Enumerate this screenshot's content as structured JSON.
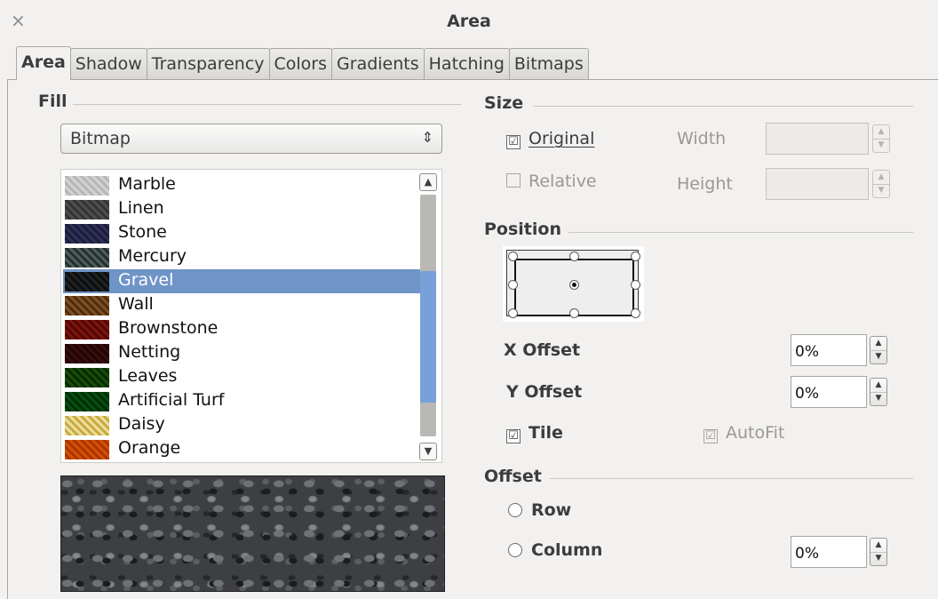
{
  "window": {
    "title": "Area",
    "close_glyph": "×"
  },
  "tabs": [
    "Area",
    "Shadow",
    "Transparency",
    "Colors",
    "Gradients",
    "Hatching",
    "Bitmaps"
  ],
  "fill": {
    "group_label": "Fill",
    "type_value": "Bitmap",
    "bitmaps": [
      {
        "label": "Marble",
        "swatch_colors": [
          "#e7e7e7",
          "#c8c8c8"
        ]
      },
      {
        "label": "Linen",
        "swatch_colors": [
          "#8d8d8d",
          "#5c5c5c"
        ]
      },
      {
        "label": "Stone",
        "swatch_colors": [
          "#6e6f94",
          "#3d3f63"
        ]
      },
      {
        "label": "Mercury",
        "swatch_colors": [
          "#8c9a98",
          "#3f4a48"
        ]
      },
      {
        "label": "Gravel",
        "swatch_colors": [
          "#5a5c5f",
          "#1f2022"
        ]
      },
      {
        "label": "Wall",
        "swatch_colors": [
          "#b48e5a",
          "#6a4f2c"
        ]
      },
      {
        "label": "Brownstone",
        "swatch_colors": [
          "#b3453a",
          "#6e1e18"
        ]
      },
      {
        "label": "Netting",
        "swatch_colors": [
          "#7a3a38",
          "#3a1a18"
        ]
      },
      {
        "label": "Leaves",
        "swatch_colors": [
          "#4f8d2e",
          "#1e4a12"
        ]
      },
      {
        "label": "Artificial Turf",
        "swatch_colors": [
          "#1e8e3e",
          "#0b4d1f"
        ]
      },
      {
        "label": "Daisy",
        "swatch_colors": [
          "#f2eec8",
          "#d8b24a"
        ]
      },
      {
        "label": "Orange",
        "swatch_colors": [
          "#e98e1d",
          "#b5620c"
        ]
      }
    ],
    "selected": "Gravel"
  },
  "size": {
    "group_label": "Size",
    "original_label": "Original",
    "original_checked": true,
    "relative_label": "Relative",
    "relative_checked": false,
    "width_label": "Width",
    "width_value": "",
    "height_label": "Height",
    "height_value": ""
  },
  "position": {
    "group_label": "Position",
    "selected_point": "center",
    "x_offset_label": "X Offset",
    "x_offset_value": "0%",
    "y_offset_label": "Y Offset",
    "y_offset_value": "0%",
    "tile_label": "Tile",
    "tile_checked": true,
    "autofit_label": "AutoFit",
    "autofit_checked": true
  },
  "offset": {
    "group_label": "Offset",
    "row_label": "Row",
    "column_label": "Column",
    "value": "0%"
  },
  "icons": {
    "check": "☑",
    "combo_arrows": "⇕",
    "spin_up": "▲",
    "spin_down": "▼",
    "scroll_up": "▲",
    "scroll_down": "▼"
  }
}
